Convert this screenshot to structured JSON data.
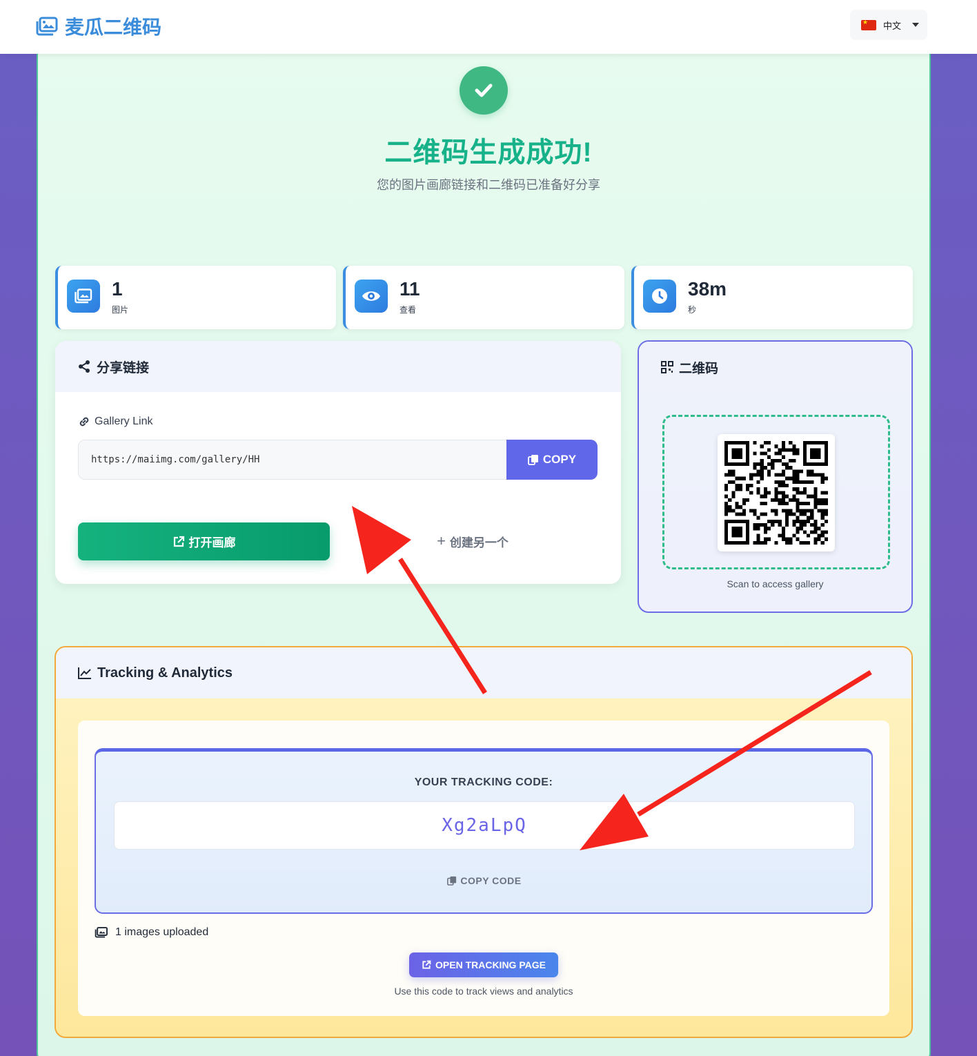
{
  "nav": {
    "brand": "麦瓜二维码",
    "language": "中文",
    "icons": {
      "brand": "images-icon",
      "flag": "china-flag-icon",
      "caret": "caret-down-icon"
    }
  },
  "hero": {
    "icon": "check-circle-icon",
    "title": "二维码生成成功!",
    "subtitle": "您的图片画廊链接和二维码已准备好分享"
  },
  "stats": [
    {
      "value": "1",
      "label": "图片",
      "icon": "images-icon"
    },
    {
      "value": "11",
      "label": "查看",
      "icon": "eye-icon"
    },
    {
      "value": "38m",
      "label": "秒",
      "icon": "clock-icon"
    }
  ],
  "share": {
    "title": "分享链接",
    "field_label": "Gallery Link",
    "link": "https://maiimg.com/gallery/HH",
    "copy_label": "COPY",
    "open_label": "打开画廊",
    "create_label": "创建另一个"
  },
  "qr": {
    "title": "二维码",
    "caption": "Scan to access gallery"
  },
  "tracking": {
    "title": "Tracking & Analytics",
    "code_label": "YOUR TRACKING CODE:",
    "code": "Xg2aLpQ",
    "copy_code_label": "COPY CODE",
    "uploaded": "1 images uploaded",
    "open_label": "OPEN TRACKING PAGE",
    "hint": "Use this code to track views and analytics"
  },
  "colors": {
    "brand": "#3b8ddb",
    "success": "#18b28a",
    "primary": "#6067e8",
    "green_button": "#15b27e",
    "annotation_arrow": "#f5241c"
  }
}
